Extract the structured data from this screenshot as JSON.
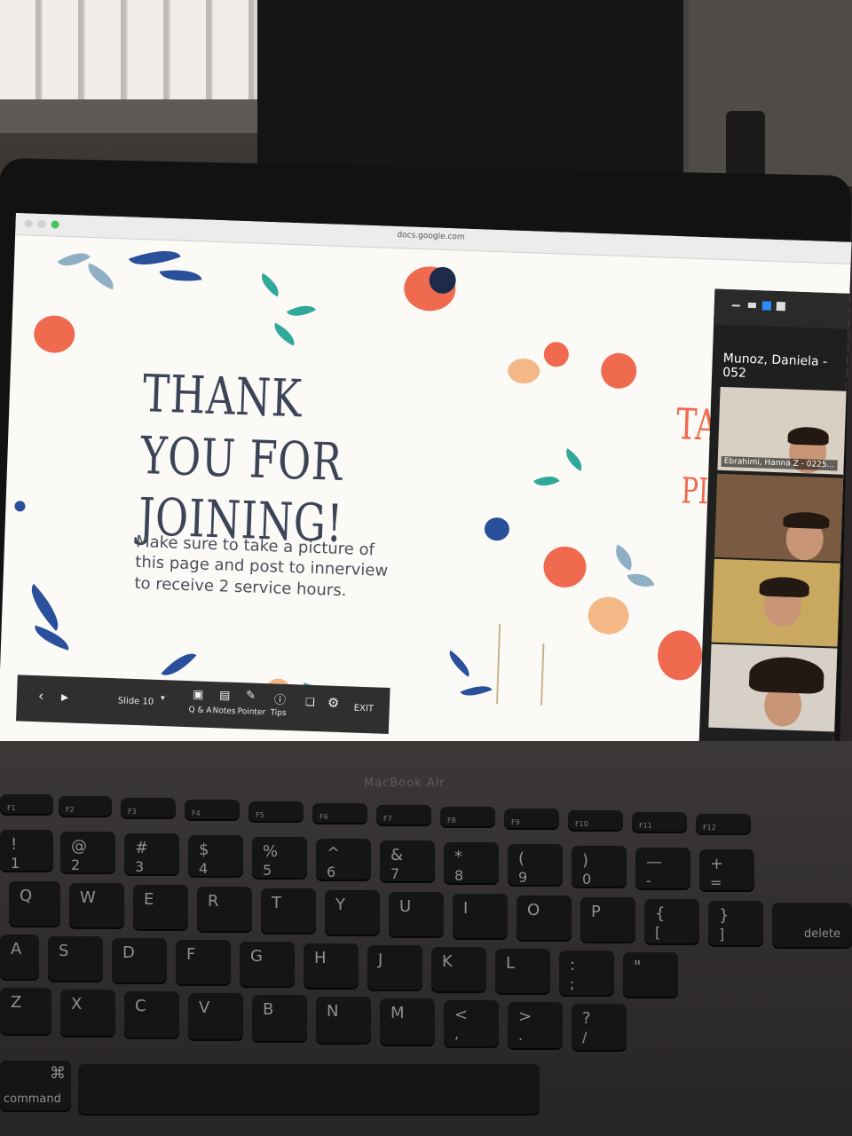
{
  "browser": {
    "url": "docs.google.com"
  },
  "slide": {
    "title_line1": "THANK YOU FOR",
    "title_line2": "JOINING!",
    "subtitle": "Make sure to take a picture of this page and post to innerview to receive 2 service hours.",
    "edge_text_1": "TAI",
    "edge_text_2": "PI"
  },
  "presenter_bar": {
    "slide_label": "Slide 10",
    "qa_label": "Q & A",
    "notes_label": "Notes",
    "pointer_label": "Pointer",
    "tips_label": "Tips",
    "exit_label": "EXIT"
  },
  "zoom": {
    "speaker_name": "Munoz, Daniela - 052",
    "participant_label": "Ebrahimi, Hanna Z - 0225...",
    "down_icon": "chevron-down-icon"
  },
  "laptop": {
    "brand": "MacBook Air"
  },
  "keyboard": {
    "fn_keys": [
      "F1",
      "F2",
      "F3",
      "F4",
      "F5",
      "F6",
      "F7",
      "F8",
      "F9",
      "F10",
      "F11",
      "F12"
    ],
    "number_row_top": [
      "!",
      "@",
      "#",
      "$",
      "%",
      "^",
      "&",
      "*",
      "(",
      ")",
      "—",
      "+"
    ],
    "number_row_bottom": [
      "1",
      "2",
      "3",
      "4",
      "5",
      "6",
      "7",
      "8",
      "9",
      "0",
      "-",
      "="
    ],
    "row_q": [
      "Q",
      "W",
      "E",
      "R",
      "T",
      "Y",
      "U",
      "I",
      "O",
      "P",
      "{",
      "}"
    ],
    "row_q_extra": [
      "[",
      "]"
    ],
    "row_a": [
      "A",
      "S",
      "D",
      "F",
      "G",
      "H",
      "J",
      "K",
      "L",
      ":",
      "\""
    ],
    "row_a_extra": [
      ";"
    ],
    "row_z": [
      "Z",
      "X",
      "C",
      "V",
      "B",
      "N",
      "M",
      "<",
      ">",
      "?"
    ],
    "row_z_extra": [
      ",",
      ".",
      "/"
    ],
    "delete_label": "delete",
    "command_label": "command",
    "command_symbol": "⌘"
  },
  "colors": {
    "title": "#3d4457",
    "orange": "#ef6a4e",
    "navy": "#2a4f9b",
    "teal": "#30a99a",
    "peach": "#f3b886"
  }
}
